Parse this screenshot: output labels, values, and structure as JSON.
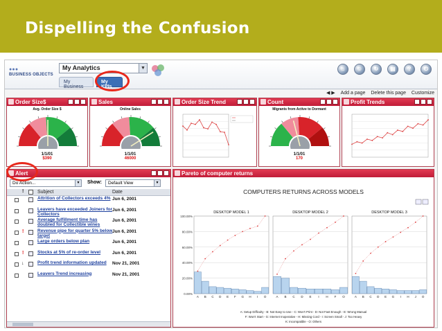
{
  "slide": {
    "title": "Dispelling the Confusion"
  },
  "app": {
    "logo": "BUSINESS OBJECTS",
    "selector": "My Analytics",
    "tabs": [
      "My Business",
      "My KPIs"
    ],
    "page_links": [
      "Add a page",
      "Delete this page",
      "Customize"
    ],
    "tool_icons": [
      "home-icon",
      "user-icon",
      "refresh-icon",
      "document-icon",
      "help-icon",
      "logout-icon"
    ]
  },
  "portlets": {
    "order_size": {
      "title": "Order Size$",
      "caption": "Avg. Order Size $",
      "date": "1/1/01",
      "value": "$390",
      "chart_data": {
        "type": "gauge",
        "title": "Avg. Order Size $",
        "bands": [
          "red",
          "pink",
          "green",
          "dark-green"
        ],
        "needle": 0.5
      }
    },
    "sales": {
      "title": "Sales",
      "caption": "Online Sales",
      "date": "1/1/01",
      "value": "46000",
      "chart_data": {
        "type": "gauge",
        "title": "Online Sales",
        "bands": [
          "red",
          "pink",
          "green",
          "dark-green"
        ],
        "needle": 0.82
      }
    },
    "order_size_trend": {
      "title": "Order Size Trend",
      "chart_data": {
        "type": "line",
        "values": [
          55,
          48,
          60,
          58,
          66,
          52,
          50,
          62,
          58,
          45,
          44,
          22
        ]
      }
    },
    "count": {
      "title": "Count",
      "caption": "Migrants from Active to Dormant",
      "date": "1/1/01",
      "value": "170",
      "chart_data": {
        "type": "gauge",
        "title": "Migrants from Active to Dormant",
        "bands": [
          "green",
          "pink",
          "red",
          "dark-red"
        ],
        "needle": 0.42
      }
    },
    "profit_trends": {
      "title": "Profit Trends",
      "chart_data": {
        "type": "line",
        "values": [
          20,
          24,
          22,
          28,
          26,
          32,
          30,
          38,
          35,
          42,
          40,
          48,
          45,
          52,
          50,
          58
        ]
      }
    },
    "alert": {
      "title": "Alert",
      "action": "Do Action...",
      "show_label": "Show:",
      "view": "Default View",
      "columns": [
        "Subject",
        "Date"
      ],
      "rows": [
        {
          "subject": "Attrition of Collectors exceeds 4%",
          "date": "Jun 6, 2001",
          "flag": false,
          "down": false
        },
        {
          "subject": "Leavers have exceeded Joiners for Collectors",
          "date": "Jun 6, 2001",
          "flag": false,
          "down": false
        },
        {
          "subject": "Average fulfillment time has doubled for Collectible wines",
          "date": "Jun 6, 2001",
          "flag": false,
          "down": false
        },
        {
          "subject": "Revenue pipe for quarter 5% below target",
          "date": "Jun 6, 2001",
          "flag": true,
          "down": false
        },
        {
          "subject": "Large orders below plan",
          "date": "Jun 6, 2001",
          "flag": false,
          "down": false
        },
        {
          "subject": "Stocks at 5% of re-order level",
          "date": "Jun 6, 2001",
          "flag": true,
          "down": false
        },
        {
          "subject": "Profit trend information updated",
          "date": "Nov 21, 2001",
          "flag": false,
          "down": true
        },
        {
          "subject": "Leavers Trend increasing",
          "date": "Nov 21, 2001",
          "flag": false,
          "down": false
        }
      ]
    },
    "pareto": {
      "title": "Pareto of computer returns",
      "chart_title": "COMPUTERS RETURNS ACROSS MODELS",
      "legend": [
        "A: Setup Difficulty - B: Not Easy to Use - C: Won't Print - D: Not Fast Enough - E: Wrong Manual",
        "F: Won't Start - G: Internet Inoperative - H: Missing Cord - I: Screen Small - J: Too Heavy",
        "K: Incompatible - O: Others"
      ],
      "chart_data": [
        {
          "type": "bar",
          "title": "DESKTOP MODEL 1",
          "categories": [
            "A",
            "B",
            "C",
            "D",
            "E",
            "F",
            "G",
            "H",
            "I",
            "O"
          ],
          "values": [
            28,
            16,
            9,
            8,
            7,
            6,
            5,
            4,
            3,
            8
          ],
          "cumulative": [
            29,
            45,
            54,
            62,
            69,
            75,
            80,
            84,
            87,
            100
          ],
          "yticks": [
            "100.00%",
            "80.00%",
            "60.00%",
            "40.00%",
            "20.00%",
            "0.00%"
          ],
          "ylim": [
            0,
            100
          ]
        },
        {
          "type": "bar",
          "title": "DESKTOP MODEL 2",
          "categories": [
            "A",
            "B",
            "C",
            "D",
            "E",
            "I",
            "H",
            "F",
            "O"
          ],
          "values": [
            22,
            20,
            8,
            7,
            6,
            6,
            6,
            5,
            8
          ],
          "cumulative": [
            25,
            45,
            55,
            63,
            70,
            78,
            85,
            92,
            100
          ],
          "ylim": [
            0,
            100
          ]
        },
        {
          "type": "bar",
          "title": "DESKTOP MODEL 3",
          "categories": [
            "A",
            "B",
            "C",
            "D",
            "E",
            "G",
            "I",
            "H",
            "J",
            "O"
          ],
          "values": [
            22,
            16,
            9,
            7,
            6,
            5,
            4,
            4,
            4,
            5
          ],
          "cumulative": [
            26,
            42,
            52,
            60,
            67,
            73,
            79,
            85,
            92,
            100
          ],
          "ylim": [
            0,
            100
          ]
        }
      ]
    }
  }
}
